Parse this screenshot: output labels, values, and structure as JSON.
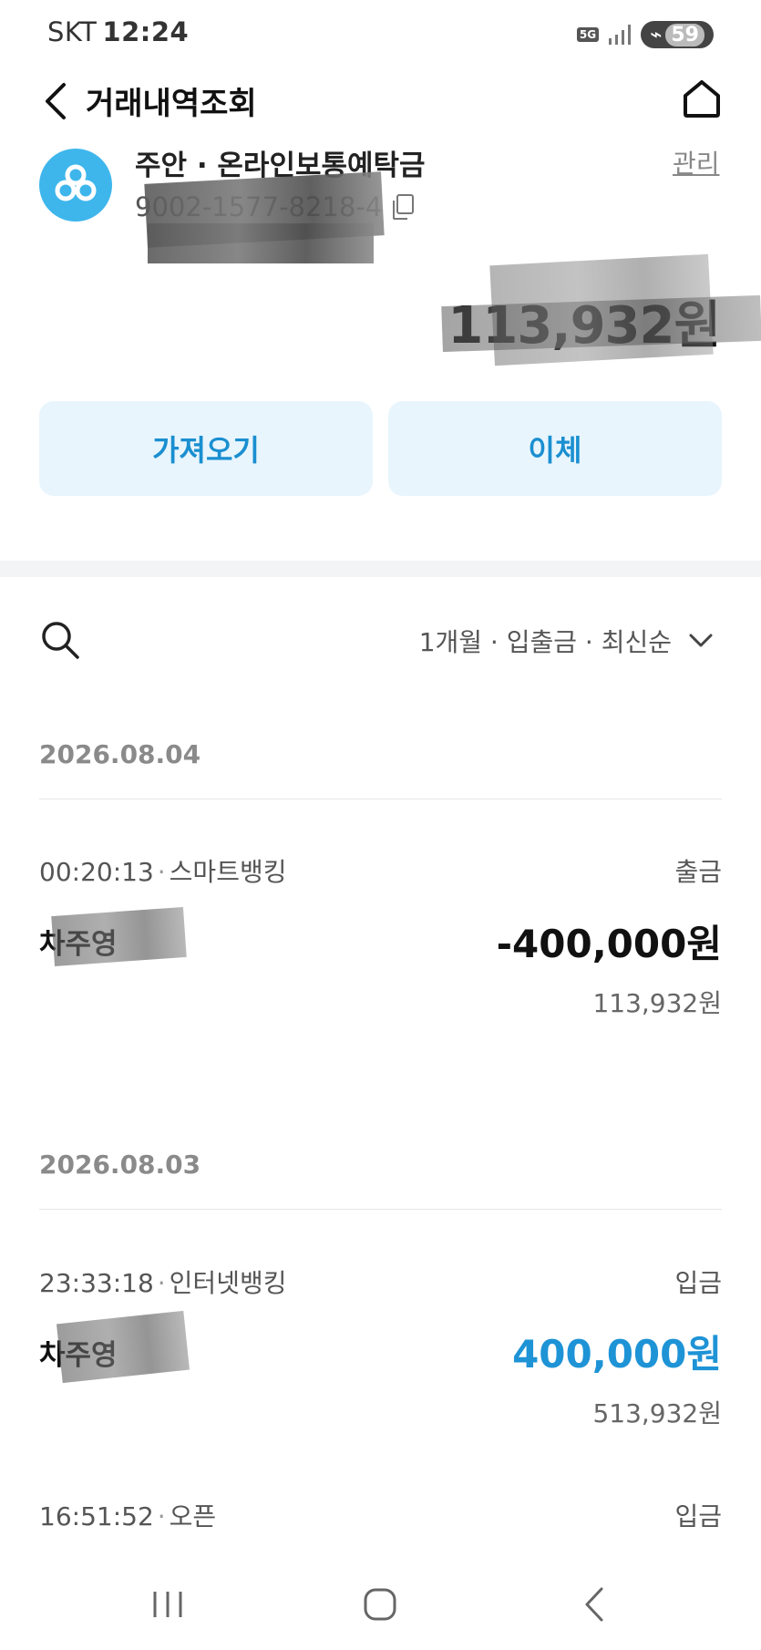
{
  "status_bar": {
    "carrier": "SKT",
    "time": "12:24",
    "network": "5G",
    "battery": "59"
  },
  "header": {
    "title": "거래내역조회"
  },
  "account": {
    "name": "주안 · 온라인보통예탁금",
    "number": "9002-1577-8218-4",
    "manage_label": "관리",
    "balance": "113,932원",
    "icon_color": "#3eb6ec"
  },
  "actions": {
    "import_label": "가져오기",
    "transfer_label": "이체"
  },
  "filter": {
    "label": "1개월 · 입출금 · 최신순"
  },
  "groups": [
    {
      "date": "2026.08.04",
      "transactions": [
        {
          "time": "00:20:13",
          "channel": "스마트뱅킹",
          "type": "출금",
          "name": "차주영",
          "amount": "-400,000원",
          "balance_after": "113,932원"
        }
      ]
    },
    {
      "date": "2026.08.03",
      "transactions": [
        {
          "time": "23:33:18",
          "channel": "인터넷뱅킹",
          "type": "입금",
          "name": "차주영",
          "amount": "400,000원",
          "balance_after": "513,932원"
        },
        {
          "time": "16:51:52",
          "channel": "오픈",
          "type": "입금"
        }
      ]
    }
  ],
  "colors": {
    "accent": "#1e93d6",
    "button_bg": "#e8f5fd",
    "muted": "#8a8a8a"
  }
}
